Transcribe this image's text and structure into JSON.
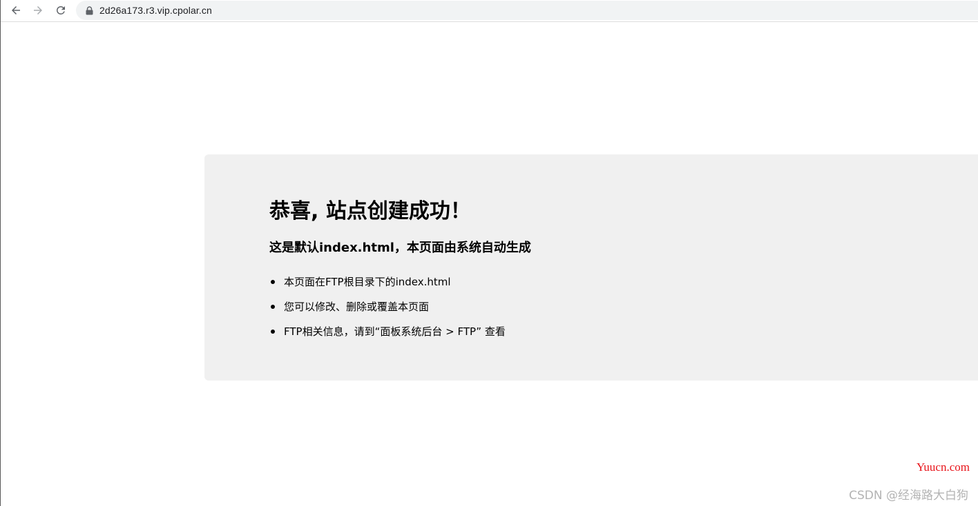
{
  "browser": {
    "url": "2d26a173.r3.vip.cpolar.cn",
    "icons": {
      "back": "arrow-left-icon",
      "forward": "arrow-right-icon",
      "reload": "reload-icon",
      "lock": "lock-icon"
    }
  },
  "page": {
    "title": "恭喜, 站点创建成功！",
    "subtitle": "这是默认index.html，本页面由系统自动生成",
    "items": [
      "本页面在FTP根目录下的index.html",
      "您可以修改、删除或覆盖本页面",
      "FTP相关信息，请到“面板系统后台 > FTP” 查看"
    ]
  },
  "watermarks": {
    "site": "Yuucn.com",
    "author": "CSDN @经海路大白狗"
  },
  "colors": {
    "panel_bg": "#f0f0f0",
    "omnibox_bg": "#f1f3f4",
    "watermark_site": "#e8141a",
    "watermark_author": "#b3b3b3"
  }
}
